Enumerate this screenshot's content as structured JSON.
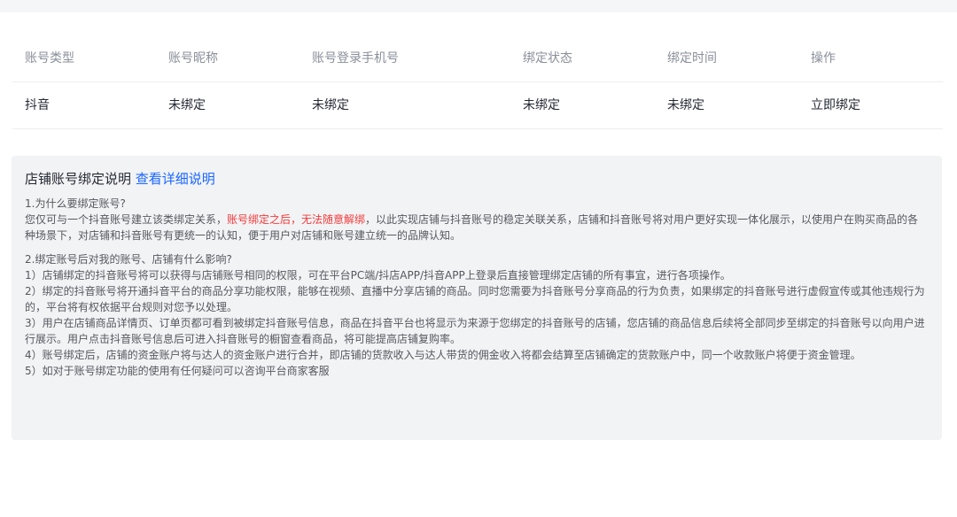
{
  "table": {
    "headers": [
      "账号类型",
      "账号昵称",
      "账号登录手机号",
      "绑定状态",
      "绑定时间",
      "操作"
    ],
    "row": {
      "type": "抖音",
      "nickname": "未绑定",
      "phone": "未绑定",
      "status": "未绑定",
      "time": "未绑定",
      "action": "立即绑定"
    }
  },
  "description": {
    "title": "店铺账号绑定说明",
    "detail_link": "查看详细说明",
    "q1": {
      "title": "1.为什么要绑定账号?",
      "text_before": "您仅可与一个抖音账号建立该类绑定关系，",
      "text_red": "账号绑定之后，无法随意解绑",
      "text_after": "，以此实现店铺与抖音账号的稳定关联关系，店铺和抖音账号将对用户更好实现一体化展示，以使用户在购买商品的各种场景下，对店铺和抖音账号有更统一的认知，便于用户对店铺和账号建立统一的品牌认知。"
    },
    "q2": {
      "title": "2.绑定账号后对我的账号、店铺有什么影响?",
      "items": [
        "1）店铺绑定的抖音账号将可以获得与店铺账号相同的权限，可在平台PC端/抖店APP/抖音APP上登录后直接管理绑定店铺的所有事宜，进行各项操作。",
        "2）绑定的抖音账号将开通抖音平台的商品分享功能权限，能够在视频、直播中分享店铺的商品。同时您需要为抖音账号分享商品的行为负责，如果绑定的抖音账号进行虚假宣传或其他违规行为的，平台将有权依据平台规则对您予以处理。",
        "3）用户在店铺商品详情页、订单页都可看到被绑定抖音账号信息，商品在抖音平台也将显示为来源于您绑定的抖音账号的店铺，您店铺的商品信息后续将全部同步至绑定的抖音账号以向用户进行展示。用户点击抖音账号信息后可进入抖音账号的橱窗查看商品，将可能提高店铺复购率。",
        "4）账号绑定后，店铺的资金账户将与达人的资金账户进行合并，即店铺的货款收入与达人带货的佣金收入将都会结算至店铺确定的货款账户中，同一个收款账户将便于资金管理。",
        "5）如对于账号绑定功能的使用有任何疑问可以咨询平台商家客服"
      ]
    }
  }
}
